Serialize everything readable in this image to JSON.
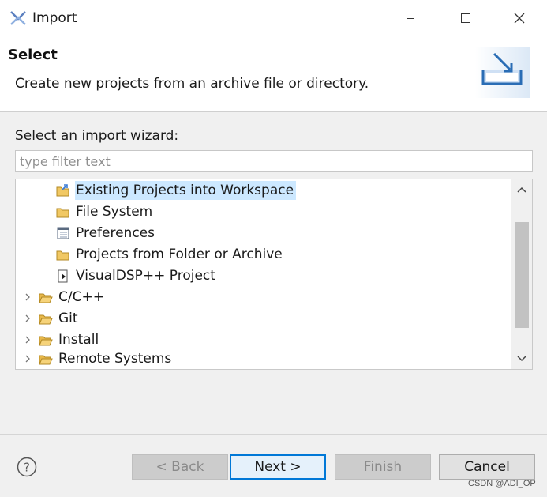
{
  "window": {
    "title": "Import"
  },
  "header": {
    "title": "Select",
    "description": "Create new projects from an archive file or directory."
  },
  "wizard": {
    "label": "Select an import wizard:",
    "filter_placeholder": "type filter text",
    "filter_value": ""
  },
  "tree": {
    "items": [
      {
        "label": "Existing Projects into Workspace",
        "icon": "project-import-icon",
        "selected": true
      },
      {
        "label": "File System",
        "icon": "folder-icon"
      },
      {
        "label": "Preferences",
        "icon": "preferences-icon"
      },
      {
        "label": "Projects from Folder or Archive",
        "icon": "folder-icon"
      },
      {
        "label": "VisualDSP++ Project",
        "icon": "visualdsp-project-icon"
      },
      {
        "label": "C/C++",
        "icon": "open-folder-icon",
        "collapsed": true
      },
      {
        "label": "Git",
        "icon": "open-folder-icon",
        "collapsed": true
      },
      {
        "label": "Install",
        "icon": "open-folder-icon",
        "collapsed": true
      },
      {
        "label": "Remote Systems",
        "icon": "open-folder-icon",
        "collapsed": true
      }
    ]
  },
  "buttons": {
    "back": "< Back",
    "next": "Next >",
    "finish": "Finish",
    "cancel": "Cancel"
  },
  "watermark": "CSDN @ADI_OP",
  "colors": {
    "selection": "#cce8ff",
    "default_button_border": "#0078d7",
    "folder": "#e8b84a"
  }
}
